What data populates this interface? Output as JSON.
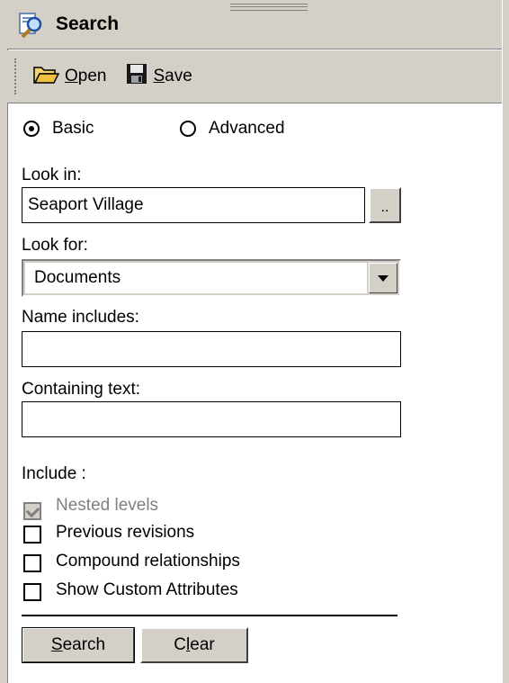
{
  "panel": {
    "title": "Search",
    "title_icon": "search-magnifier-icon"
  },
  "toolbar": {
    "open": {
      "label": "Open",
      "mnemonic": "O",
      "rest": "pen",
      "icon": "folder-open-icon"
    },
    "save": {
      "label": "Save",
      "mnemonic": "S",
      "rest": "ave",
      "icon": "floppy-disk-icon"
    }
  },
  "mode": {
    "basic_label": "Basic",
    "advanced_label": "Advanced",
    "selected": "Basic"
  },
  "look_in": {
    "label": "Look in:",
    "value": "Seaport Village",
    "browse_label": ".."
  },
  "look_for": {
    "label": "Look for:",
    "value": "Documents"
  },
  "name_includes": {
    "label": "Name includes:",
    "value": ""
  },
  "containing_text": {
    "label": "Containing text:",
    "value": ""
  },
  "include": {
    "label": "Include :",
    "options": [
      {
        "label": "Nested levels",
        "checked": true,
        "disabled": true
      },
      {
        "label": "Previous revisions",
        "checked": false,
        "disabled": false
      },
      {
        "label": "Compound relationships",
        "checked": false,
        "disabled": false
      },
      {
        "label": "Show Custom Attributes",
        "checked": false,
        "disabled": false
      }
    ]
  },
  "actions": {
    "search": {
      "label": "Search",
      "mnemonic": "S",
      "rest": "earch"
    },
    "clear": {
      "label": "Clear",
      "pre": "C",
      "mnemonic": "l",
      "rest": "ear"
    }
  }
}
